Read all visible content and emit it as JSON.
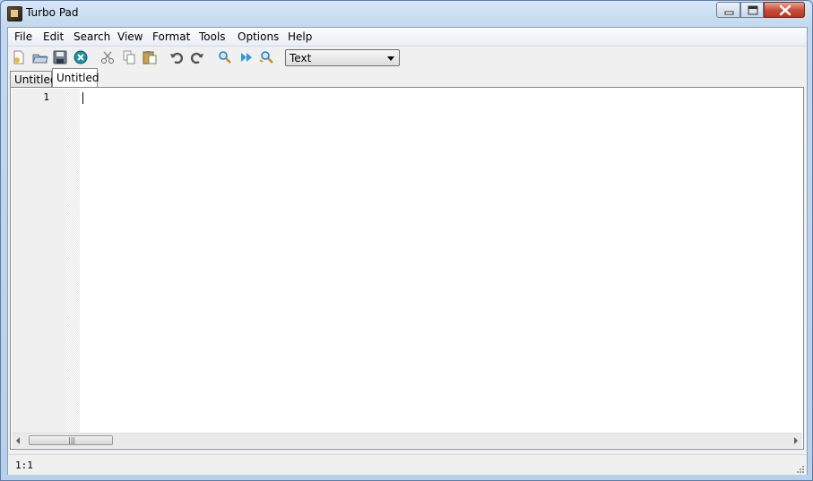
{
  "window": {
    "title": "Turbo Pad"
  },
  "menu": [
    "File",
    "Edit",
    "Search",
    "View",
    "Format",
    "Tools",
    "Options",
    "Help"
  ],
  "toolbar": {
    "icons": [
      "new-file-icon",
      "open-file-icon",
      "save-icon",
      "close-file-icon",
      "cut-icon",
      "copy-icon",
      "paste-icon",
      "undo-icon",
      "redo-icon",
      "find-icon",
      "find-next-icon",
      "replace-icon"
    ],
    "syntax_mode": "Text"
  },
  "tabs": [
    {
      "label": "Untitled"
    },
    {
      "label": "Untitled"
    }
  ],
  "editor": {
    "line_numbers": [
      "1"
    ],
    "content": ""
  },
  "status": {
    "position": "1:1"
  },
  "colors": {
    "titlebar": "#c3d8ee",
    "close_button": "#c9503b",
    "editor_bg": "#ffffff",
    "gutter_bg": "#f0f0f0"
  }
}
